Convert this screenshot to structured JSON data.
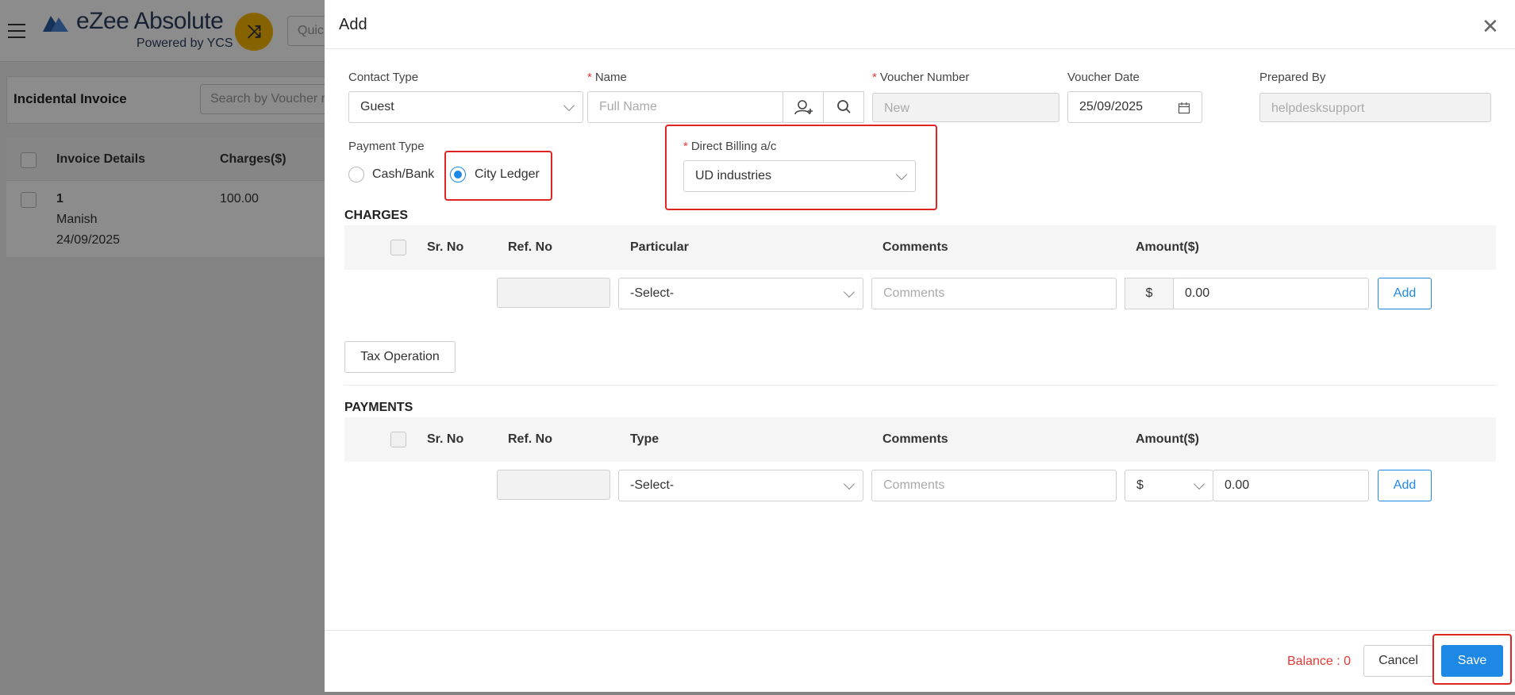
{
  "app": {
    "logo_text": "eZee Absolute",
    "logo_sub": "Powered by YCS",
    "quick_search_placeholder": "Quic",
    "page_title": "Incidental Invoice",
    "list_search_placeholder": "Search by Voucher r",
    "grid": {
      "columns": [
        "Invoice Details",
        "Charges($)"
      ],
      "rows": [
        {
          "no": "1",
          "name": "Manish",
          "date": "24/09/2025",
          "charges": "100.00"
        }
      ]
    }
  },
  "modal": {
    "title": "Add",
    "contact_type": {
      "label": "Contact Type",
      "value": "Guest"
    },
    "name": {
      "label": "Name",
      "placeholder": "Full Name"
    },
    "voucher_number": {
      "label": "Voucher Number",
      "placeholder": "New"
    },
    "voucher_date": {
      "label": "Voucher Date",
      "value": "25/09/2025"
    },
    "prepared_by": {
      "label": "Prepared By",
      "value": "helpdesksupport"
    },
    "payment_type": {
      "label": "Payment Type",
      "options": [
        "Cash/Bank",
        "City Ledger"
      ],
      "selected": "City Ledger"
    },
    "direct_billing": {
      "label": "Direct Billing a/c",
      "value": "UD industries"
    },
    "charges": {
      "title": "CHARGES",
      "columns": [
        "Sr. No",
        "Ref. No",
        "Particular",
        "Comments",
        "Amount($)"
      ],
      "row": {
        "particular": "-Select-",
        "comments_placeholder": "Comments",
        "currency": "$",
        "amount": "0.00",
        "add_label": "Add"
      }
    },
    "tax_operation_label": "Tax Operation",
    "payments": {
      "title": "PAYMENTS",
      "columns": [
        "Sr. No",
        "Ref. No",
        "Type",
        "Comments",
        "Amount($)"
      ],
      "row": {
        "type": "-Select-",
        "comments_placeholder": "Comments",
        "currency": "$",
        "amount": "0.00",
        "add_label": "Add"
      }
    },
    "footer": {
      "balance": "Balance : 0",
      "cancel_label": "Cancel",
      "save_label": "Save"
    }
  },
  "colors": {
    "primary": "#1e88e5",
    "danger": "#e53935",
    "highlight": "#e02424",
    "accent": "#f4b400"
  },
  "icons": [
    "menu-icon",
    "logo-icon",
    "shuffle-icon",
    "close-icon",
    "add-person-icon",
    "search-icon",
    "calendar-icon",
    "chevron-down-icon"
  ]
}
